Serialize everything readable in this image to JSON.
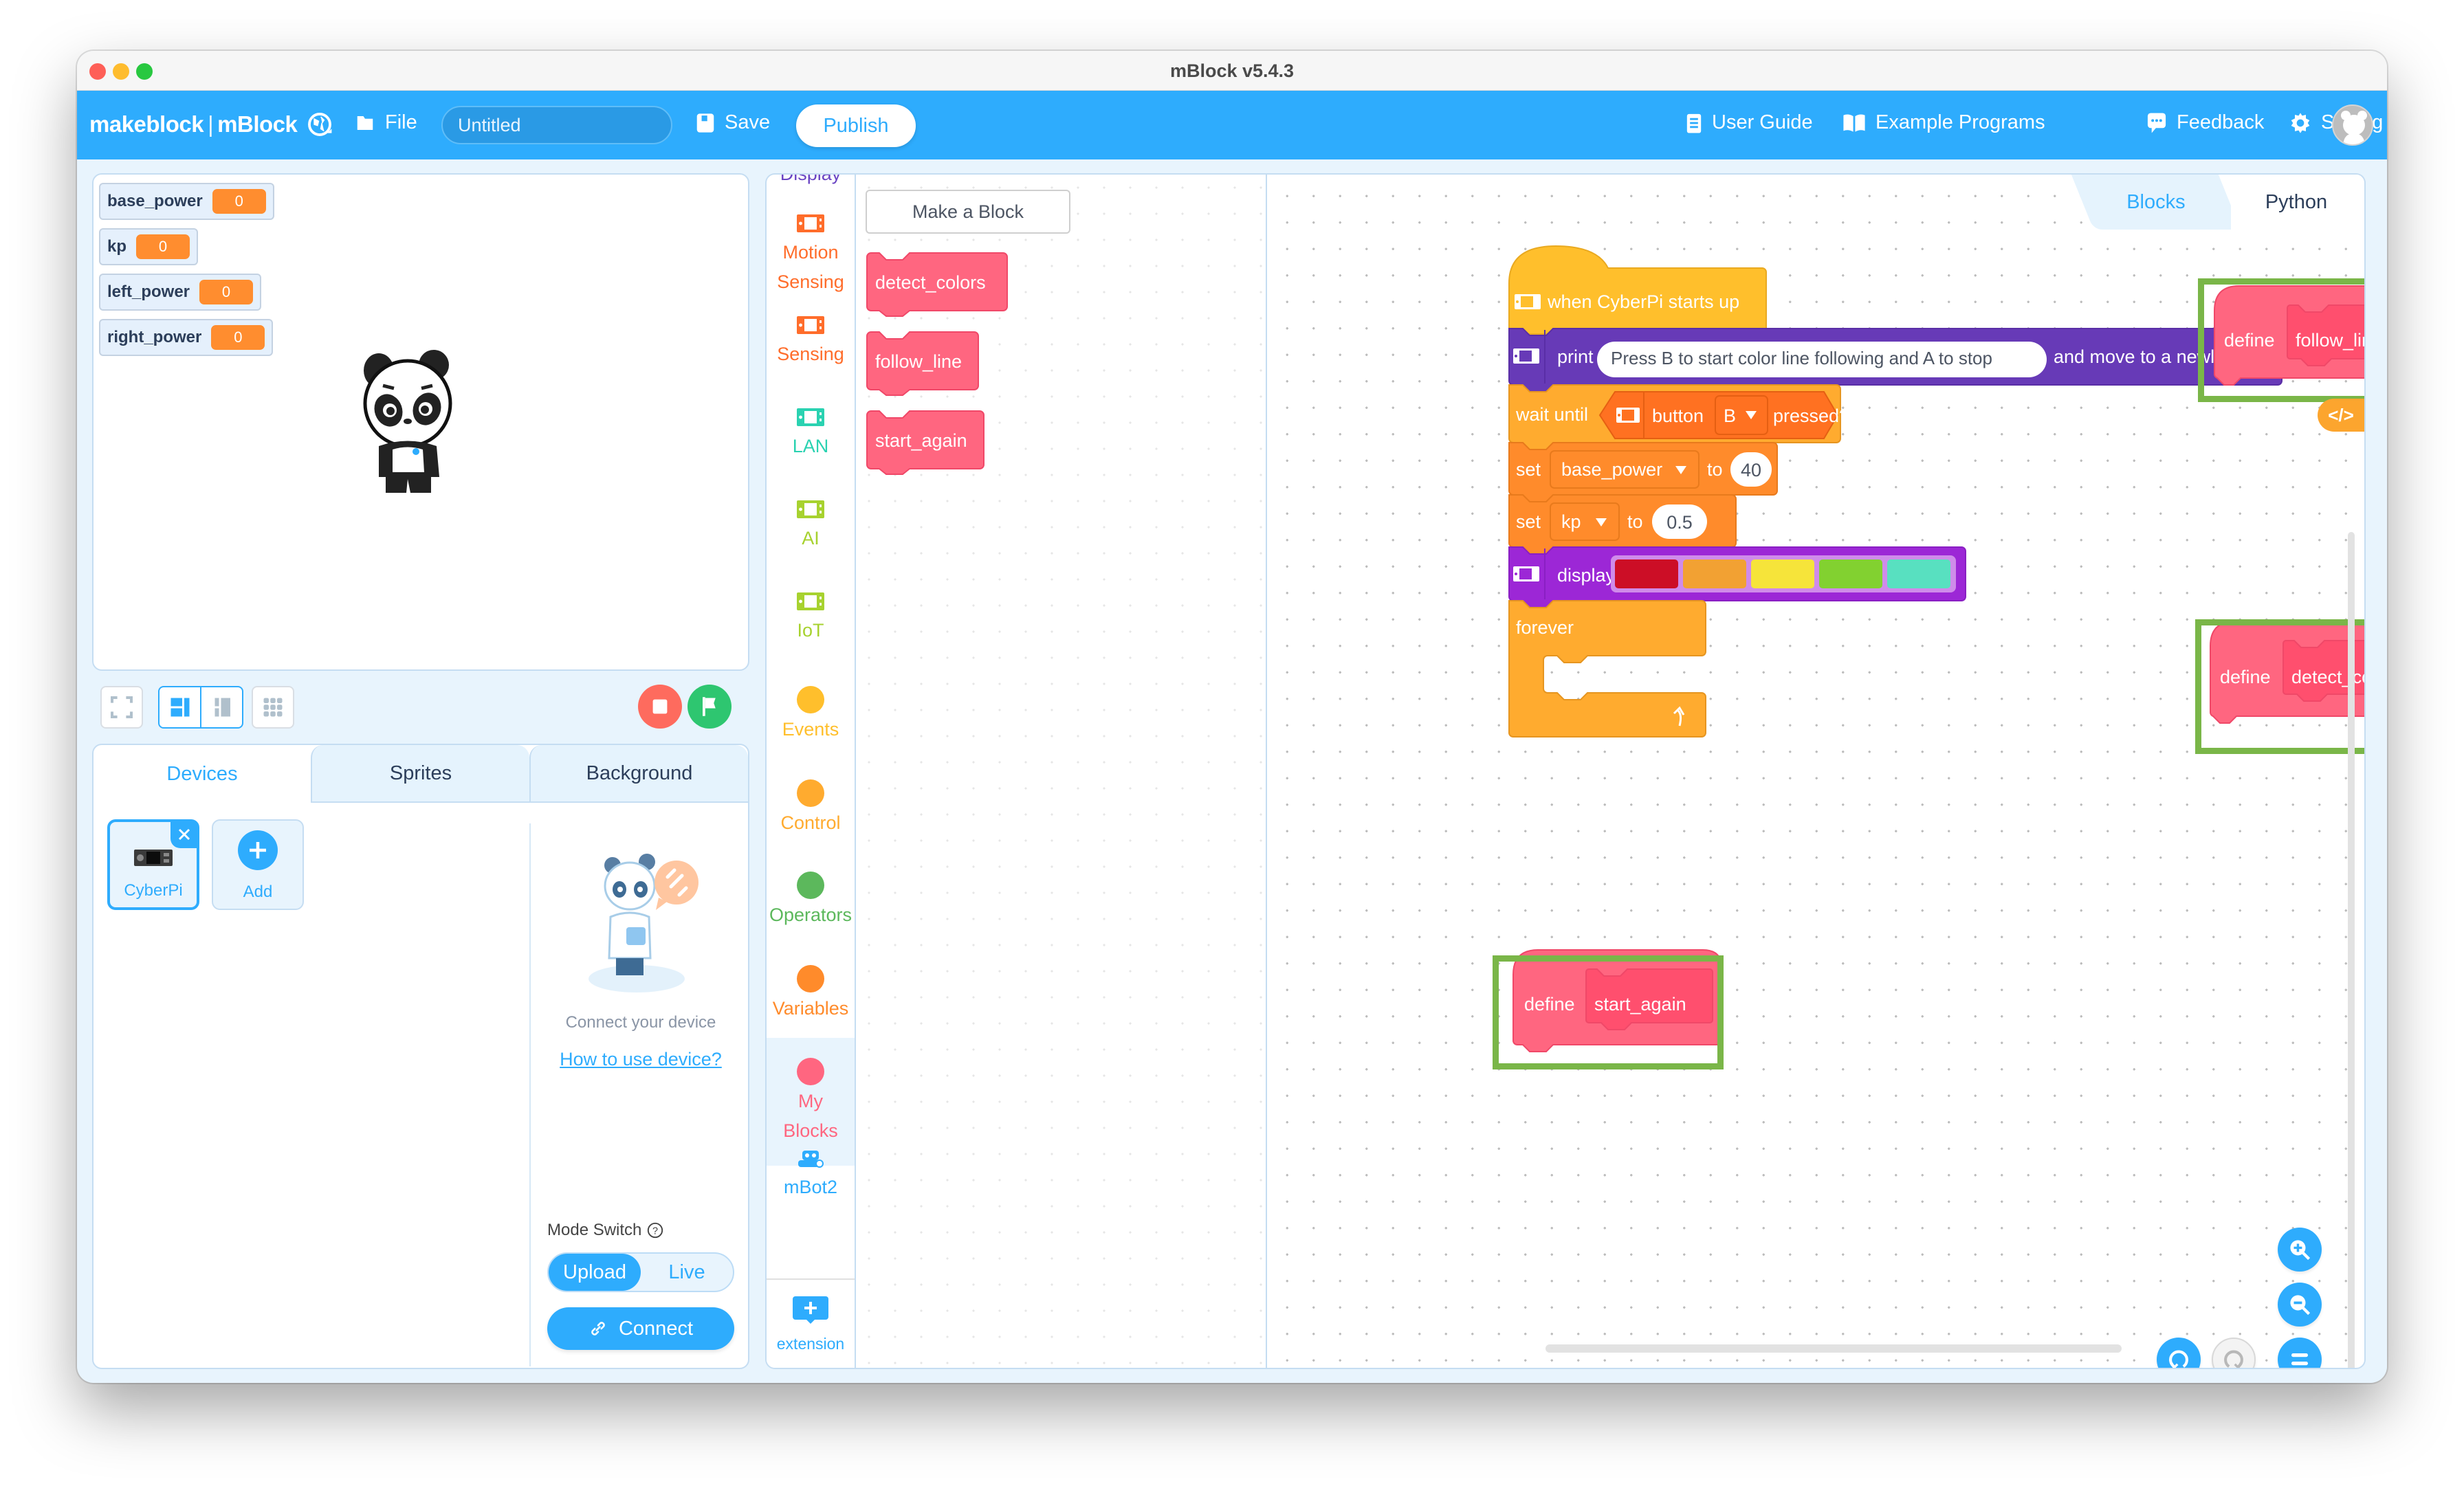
{
  "window": {
    "title": "mBlock v5.4.3"
  },
  "header": {
    "logo_brand": "makeblock",
    "logo_product": "mBlock",
    "file_label": "File",
    "project_title": "Untitled",
    "save_label": "Save",
    "publish_label": "Publish",
    "user_guide_label": "User Guide",
    "example_programs_label": "Example Programs",
    "feedback_label": "Feedback",
    "setting_label": "Setting"
  },
  "stage": {
    "monitors": [
      {
        "name": "base_power",
        "value": "0"
      },
      {
        "name": "kp",
        "value": "0"
      },
      {
        "name": "left_power",
        "value": "0"
      },
      {
        "name": "right_power",
        "value": "0"
      }
    ]
  },
  "device_panel": {
    "tabs": [
      "Devices",
      "Sprites",
      "Background"
    ],
    "active_tab": "Devices",
    "devices": [
      {
        "label": "CyberPi",
        "selected": true
      }
    ],
    "add_label": "Add",
    "connect_hint": "Connect your device",
    "howto_link": "How to use device?",
    "mode_switch_label": "Mode Switch",
    "mode_options": [
      "Upload",
      "Live"
    ],
    "mode_active": "Upload",
    "connect_label": "Connect"
  },
  "categories": {
    "partial_top": "Display",
    "items": [
      {
        "label": "Motion Sensing",
        "color": "#ff6d2b",
        "icon": "cyberpi-icon"
      },
      {
        "label": "Sensing",
        "color": "#ff6d2b",
        "icon": "cyberpi-icon"
      },
      {
        "label": "LAN",
        "color": "#2ad2b1",
        "icon": "cyberpi-icon"
      },
      {
        "label": "AI",
        "color": "#a7d22f",
        "icon": "cyberpi-icon"
      },
      {
        "label": "IoT",
        "color": "#a7d22f",
        "icon": "cyberpi-icon"
      },
      {
        "label": "Events",
        "color": "#ffbf2c",
        "icon": "dot"
      },
      {
        "label": "Control",
        "color": "#ffab2f",
        "icon": "dot"
      },
      {
        "label": "Operators",
        "color": "#5cb85c",
        "icon": "dot"
      },
      {
        "label": "Variables",
        "color": "#ff8b2b",
        "icon": "dot"
      },
      {
        "label": "My Blocks",
        "color": "#ff6680",
        "icon": "dot",
        "active": true
      },
      {
        "label": "mBot2",
        "color": "#2eacfd",
        "icon": "mbot2-icon"
      }
    ],
    "extension_label": "extension"
  },
  "palette": {
    "make_block_label": "Make a Block",
    "blocks": [
      "detect_colors",
      "follow_line",
      "start_again"
    ]
  },
  "workspace": {
    "tabs": [
      "Blocks",
      "Python"
    ],
    "active_tab": "Blocks",
    "code_toggle": "</>",
    "script": {
      "hat": "when CyberPi starts up",
      "print": {
        "label": "print",
        "text": "Press B to start color line following and A to stop",
        "suffix": "and move to a newline"
      },
      "wait_until": {
        "label": "wait until",
        "button_label": "button",
        "button_value": "B",
        "suffix": "pressed?"
      },
      "set1": {
        "label": "set",
        "variable": "base_power",
        "to": "to",
        "value": "40"
      },
      "set2": {
        "label": "set",
        "variable": "kp",
        "to": "to",
        "value": "0.5"
      },
      "display": {
        "label": "display",
        "colors": [
          "#cc0e26",
          "#f2a133",
          "#f6e43a",
          "#82d130",
          "#58e0c0"
        ]
      },
      "forever": "forever"
    },
    "define_blocks": [
      {
        "define": "define",
        "name": "follow_line",
        "highlighted": true
      },
      {
        "define": "define",
        "name": "detect_colors",
        "highlighted": true
      },
      {
        "define": "define",
        "name": "start_again",
        "highlighted": true
      }
    ]
  },
  "colors": {
    "brand_blue": "#2eacfd",
    "my_blocks_pink": "#ff6680",
    "highlight_green": "#7ab648",
    "variable_orange": "#ff8d2f",
    "event_yellow": "#ffbf2c",
    "display_purple": "#673ab7"
  }
}
